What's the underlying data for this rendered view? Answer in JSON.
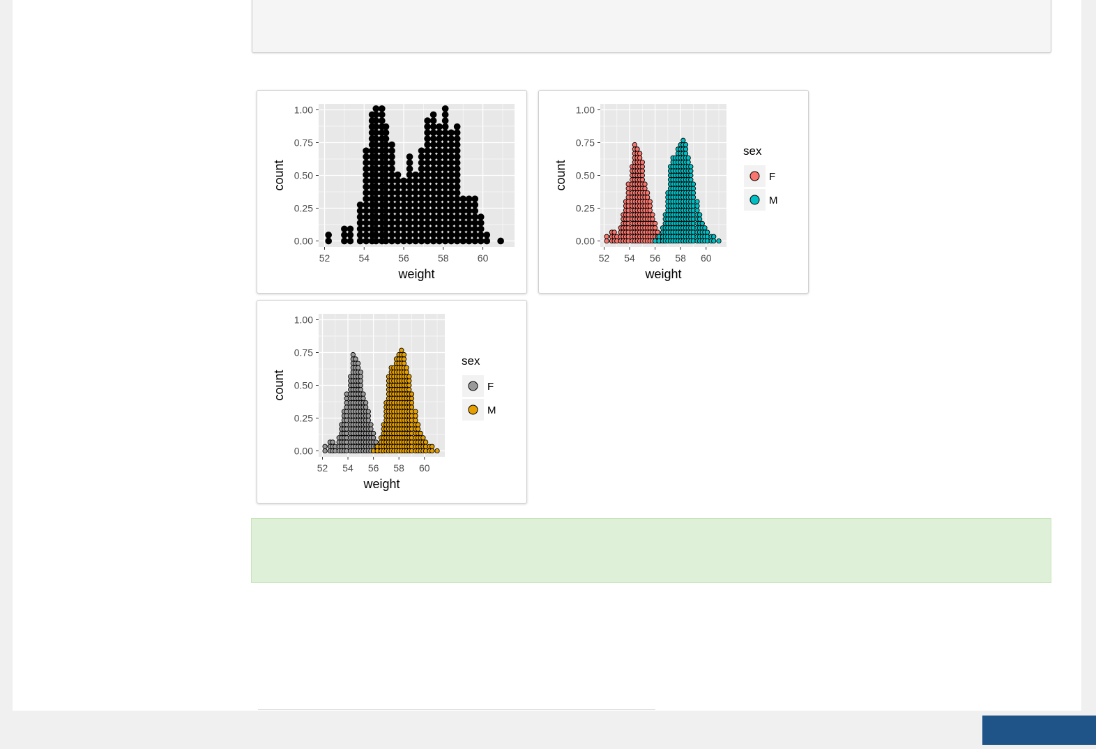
{
  "colors": {
    "panel_bg": "#e8e8e8",
    "grid": "#ffffff",
    "default_fill": "#000000",
    "fill_F_default": "#f8766d",
    "fill_M_default": "#00bfc4",
    "fill_F_manual": "#999999",
    "fill_M_manual": "#e69f00",
    "note_bg": "#dff0d8",
    "footer_button": "#1f5488"
  },
  "chart_data": [
    {
      "type": "dotplot",
      "xlabel": "weight",
      "ylabel": "count",
      "xlim": [
        51.7,
        61.6
      ],
      "ylim": [
        -0.045,
        1.045
      ],
      "x_ticks": [
        52,
        54,
        56,
        58,
        60
      ],
      "x_tick_labels": [
        "52",
        "54",
        "56",
        "58",
        "60"
      ],
      "y_ticks": [
        0,
        0.25,
        0.5,
        0.75,
        1
      ],
      "y_tick_labels": [
        "0.00",
        "0.25",
        "0.50",
        "0.75",
        "1.00"
      ],
      "grid": true,
      "binwidth": 0.27,
      "dot_fill": "#000000",
      "series": [
        {
          "fill": "#000000",
          "x": [
            52.2,
            53.0,
            53.3,
            53.8,
            54.1,
            54.4,
            54.6,
            54.9,
            55.1,
            55.4,
            55.7,
            56.0,
            56.3,
            56.6,
            56.9,
            57.2,
            57.5,
            57.8,
            58.1,
            58.4,
            58.7,
            59.0,
            59.3,
            59.6,
            59.9,
            60.2,
            60.9
          ],
          "counts": [
            2,
            3,
            3,
            7,
            16,
            22,
            23,
            23,
            20,
            17,
            12,
            11,
            15,
            12,
            16,
            21,
            22,
            20,
            23,
            19,
            20,
            8,
            8,
            8,
            5,
            2,
            1
          ]
        }
      ]
    },
    {
      "type": "dotplot",
      "xlabel": "weight",
      "ylabel": "count",
      "xlim": [
        51.7,
        61.6
      ],
      "ylim": [
        -0.045,
        1.045
      ],
      "x_ticks": [
        52,
        54,
        56,
        58,
        60
      ],
      "x_tick_labels": [
        "52",
        "54",
        "56",
        "58",
        "60"
      ],
      "y_ticks": [
        0,
        0.25,
        0.5,
        0.75,
        1
      ],
      "y_tick_labels": [
        "0.00",
        "0.25",
        "0.50",
        "0.75",
        "1.00"
      ],
      "grid": true,
      "binwidth": 0.24,
      "legend": {
        "title": "sex",
        "position": "right"
      },
      "series": [
        {
          "name": "F",
          "fill": "#f8766d",
          "x": [
            52.2,
            52.6,
            52.8,
            53.0,
            53.3,
            53.5,
            53.7,
            53.9,
            54.2,
            54.4,
            54.6,
            54.8,
            55.0,
            55.2,
            55.4,
            55.6,
            55.8,
            56.0,
            56.2,
            56.4,
            56.7
          ],
          "counts": [
            2,
            3,
            3,
            2,
            4,
            7,
            10,
            14,
            18,
            23,
            22,
            21,
            19,
            14,
            12,
            10,
            7,
            5,
            3,
            2,
            1
          ]
        },
        {
          "name": "M",
          "fill": "#00bfc4",
          "x": [
            56.0,
            56.3,
            56.6,
            56.8,
            57.0,
            57.2,
            57.4,
            57.6,
            57.8,
            58.0,
            58.2,
            58.4,
            58.6,
            58.8,
            59.0,
            59.3,
            59.5,
            59.7,
            59.9,
            60.1,
            60.4,
            60.6,
            61.0
          ],
          "counts": [
            1,
            2,
            4,
            7,
            12,
            18,
            20,
            20,
            22,
            23,
            24,
            23,
            20,
            18,
            14,
            10,
            7,
            5,
            4,
            3,
            2,
            2,
            1
          ]
        }
      ]
    },
    {
      "type": "dotplot",
      "xlabel": "weight",
      "ylabel": "count",
      "xlim": [
        51.7,
        61.6
      ],
      "ylim": [
        -0.045,
        1.045
      ],
      "x_ticks": [
        52,
        54,
        56,
        58,
        60
      ],
      "x_tick_labels": [
        "52",
        "54",
        "56",
        "58",
        "60"
      ],
      "y_ticks": [
        0,
        0.25,
        0.5,
        0.75,
        1
      ],
      "y_tick_labels": [
        "0.00",
        "0.25",
        "0.50",
        "0.75",
        "1.00"
      ],
      "grid": true,
      "binwidth": 0.24,
      "legend": {
        "title": "sex",
        "position": "right"
      },
      "series": [
        {
          "name": "F",
          "fill": "#999999",
          "x": [
            52.2,
            52.6,
            52.8,
            53.0,
            53.3,
            53.5,
            53.7,
            53.9,
            54.2,
            54.4,
            54.6,
            54.8,
            55.0,
            55.2,
            55.4,
            55.6,
            55.8,
            56.0,
            56.2,
            56.4,
            56.7
          ],
          "counts": [
            2,
            3,
            3,
            2,
            4,
            7,
            10,
            14,
            18,
            23,
            22,
            21,
            19,
            14,
            12,
            10,
            7,
            5,
            3,
            2,
            1
          ]
        },
        {
          "name": "M",
          "fill": "#e69f00",
          "x": [
            56.0,
            56.3,
            56.6,
            56.8,
            57.0,
            57.2,
            57.4,
            57.6,
            57.8,
            58.0,
            58.2,
            58.4,
            58.6,
            58.8,
            59.0,
            59.3,
            59.5,
            59.7,
            59.9,
            60.1,
            60.4,
            60.6,
            61.0
          ],
          "counts": [
            1,
            2,
            4,
            7,
            12,
            18,
            20,
            20,
            22,
            23,
            24,
            23,
            20,
            18,
            14,
            10,
            7,
            5,
            4,
            3,
            2,
            2,
            1
          ]
        }
      ]
    }
  ]
}
